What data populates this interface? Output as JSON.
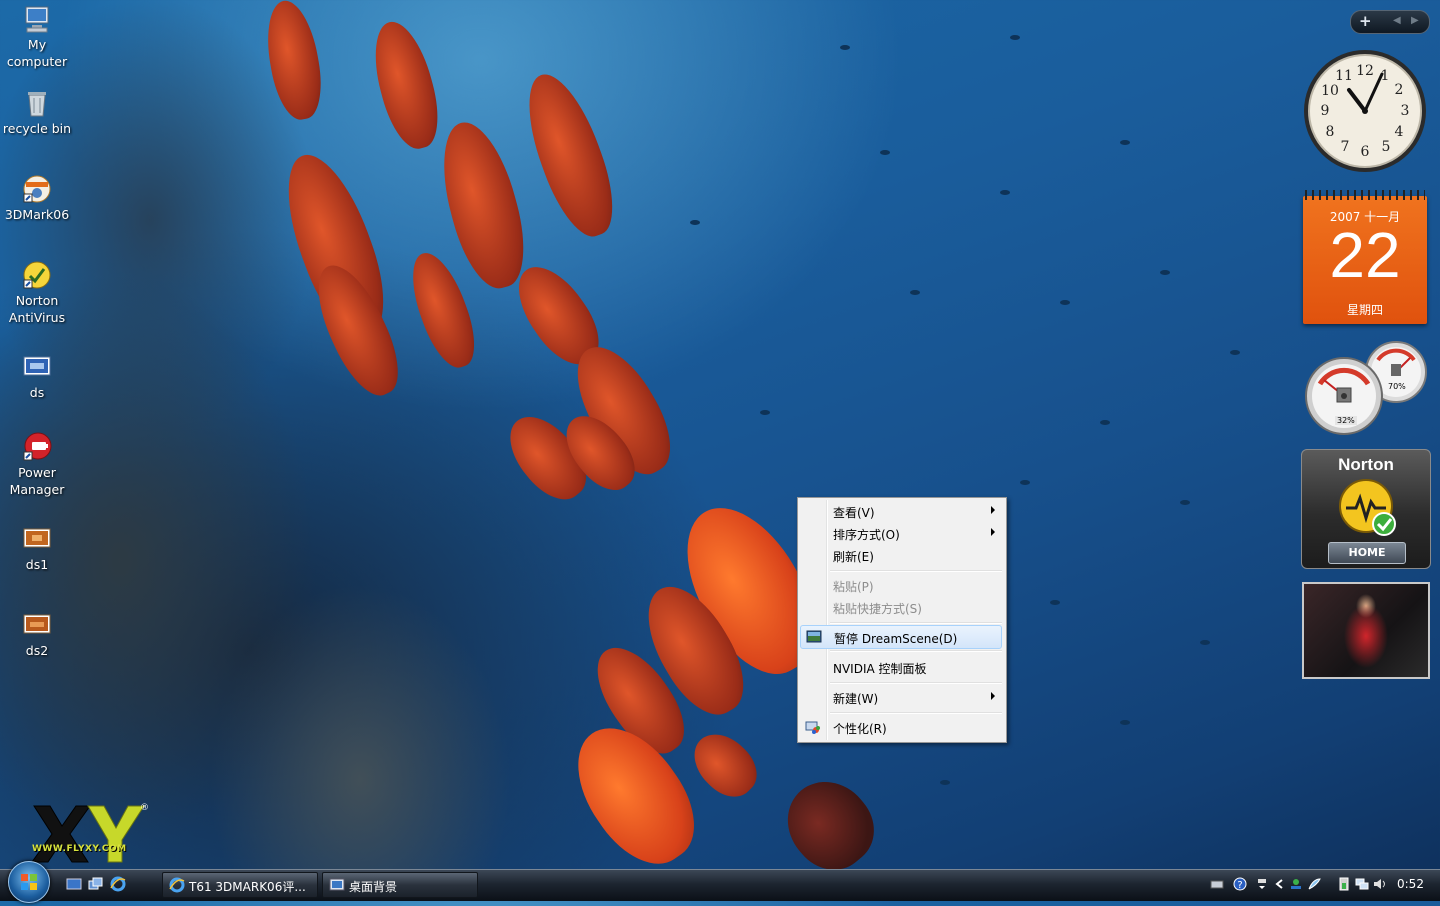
{
  "desktop_icons": [
    {
      "label": "My computer",
      "icon": "computer-icon"
    },
    {
      "label": "recycle bin",
      "icon": "recycle-bin-icon"
    },
    {
      "label": "3DMark06",
      "icon": "3dmark-icon"
    },
    {
      "label": "Norton AntiVirus",
      "icon": "norton-icon"
    },
    {
      "label": "ds",
      "icon": "image-file-icon"
    },
    {
      "label": "Power Manager",
      "icon": "power-manager-icon"
    },
    {
      "label": "ds1",
      "icon": "image-file-icon"
    },
    {
      "label": "ds2",
      "icon": "image-file-icon"
    }
  ],
  "context_menu": {
    "items": [
      {
        "label": "查看(V)",
        "submenu": true
      },
      {
        "label": "排序方式(O)",
        "submenu": true
      },
      {
        "label": "刷新(E)"
      },
      {
        "label": "粘贴(P)",
        "disabled": true
      },
      {
        "label": "粘贴快捷方式(S)",
        "disabled": true
      },
      {
        "label": "暂停 DreamScene(D)",
        "highlighted": true,
        "icon": "dreamscene-icon"
      },
      {
        "label": "NVIDIA 控制面板"
      },
      {
        "label": "新建(W)",
        "submenu": true
      },
      {
        "label": "个性化(R)",
        "icon": "personalize-icon"
      }
    ]
  },
  "gadgets": {
    "clock": {
      "time": "11:52"
    },
    "calendar": {
      "year_month": "2007 十一月",
      "day": "22",
      "weekday": "星期四"
    },
    "cpu_meter": {
      "cpu": "32%",
      "memory": "70%"
    },
    "norton": {
      "brand": "Norton",
      "button": "HOME"
    }
  },
  "watermark": {
    "text": "WWW.FLYXY.COM"
  },
  "taskbar": {
    "windows": [
      {
        "label": "T61 3DMARK06评...",
        "icon": "ie-icon"
      },
      {
        "label": "桌面背景",
        "icon": "control-panel-icon"
      }
    ],
    "clock": "0:52"
  },
  "colors": {
    "menu_highlight": "#d3e5fa",
    "calendar": "#e8601a",
    "taskbar": "#1d2530"
  }
}
